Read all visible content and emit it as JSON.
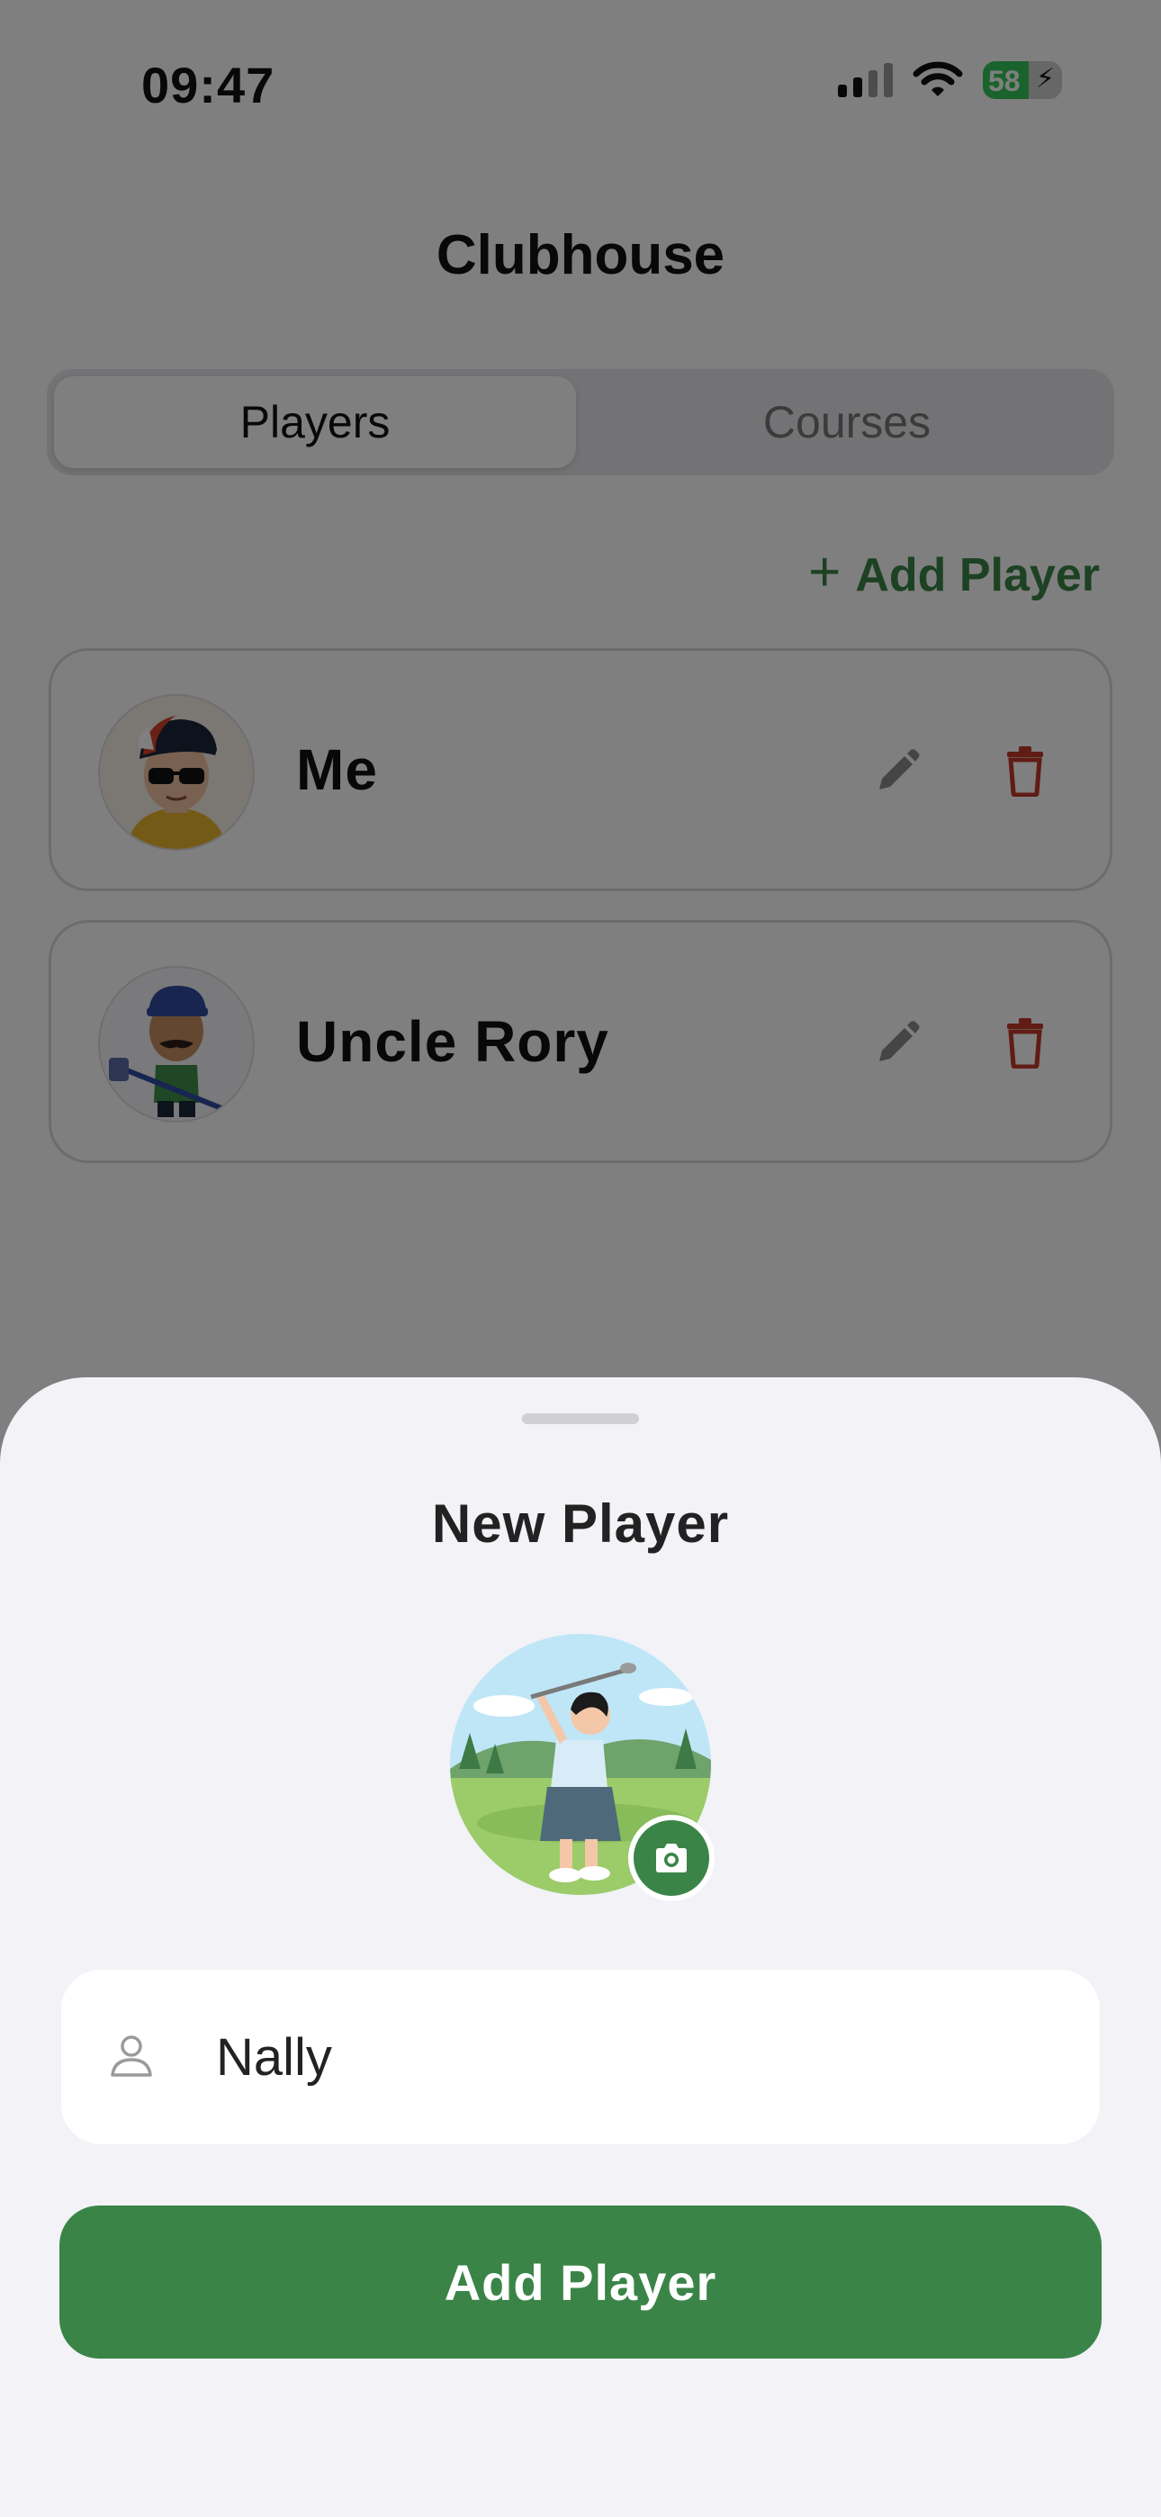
{
  "status_bar": {
    "time": "09:47",
    "battery": "58",
    "icons": [
      "signal-icon",
      "wifi-icon",
      "battery-charging-icon"
    ]
  },
  "header": {
    "title": "Clubhouse"
  },
  "tabs": [
    {
      "label": "Players",
      "selected": true
    },
    {
      "label": "Courses",
      "selected": false
    }
  ],
  "add_player_link": {
    "icon": "plus-icon",
    "label": "Add Player"
  },
  "players": [
    {
      "name": "Me",
      "avatar": "cartoon-boy-sunglasses-cap-avatar"
    },
    {
      "name": "Uncle Rory",
      "avatar": "cartoon-golfer-mustache-avatar"
    }
  ],
  "sheet": {
    "title": "New Player",
    "avatar": "woman-golfer-swinging-avatar",
    "camera_icon": "camera-icon",
    "name_field": {
      "icon": "person-icon",
      "value": "Nally"
    },
    "submit_label": "Add Player"
  },
  "colors": {
    "accent": "#3a8447",
    "delete": "#c0392b",
    "sheet_bg": "#f2f2f7",
    "overlay": "rgba(0,0,0,0.5)"
  }
}
